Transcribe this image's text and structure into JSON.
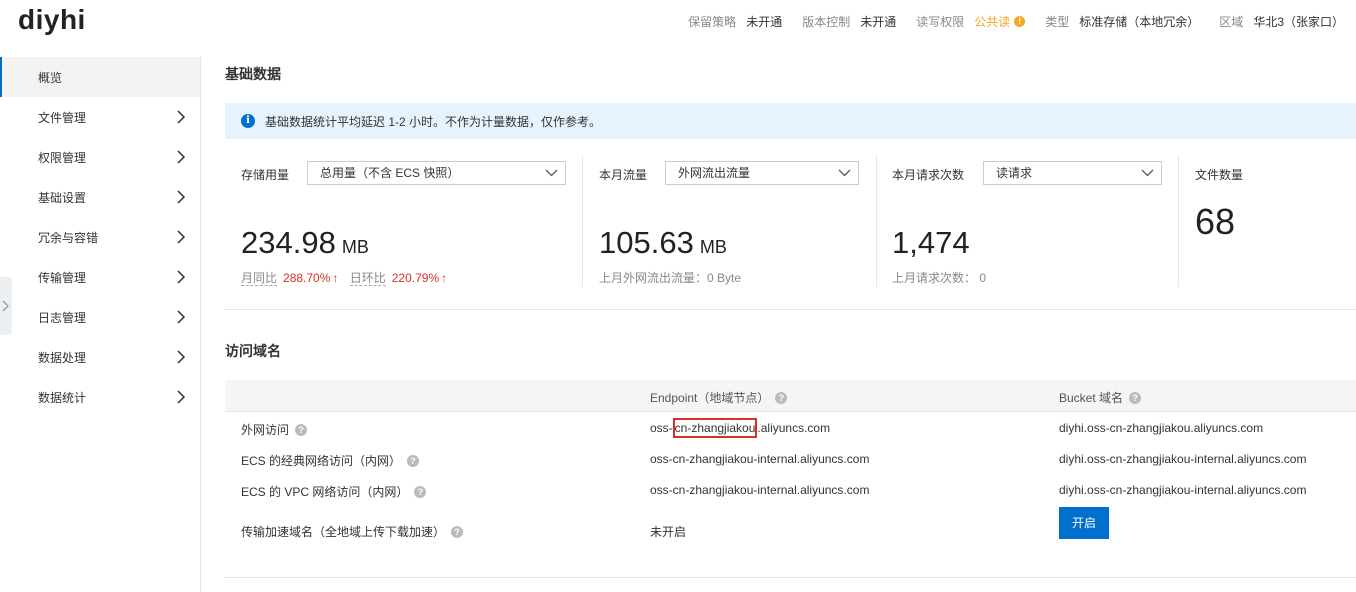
{
  "header": {
    "bucket_name": "diyhi",
    "meta": [
      {
        "label": "保留策略",
        "value": "未开通"
      },
      {
        "label": "版本控制",
        "value": "未开通"
      },
      {
        "label": "读写权限",
        "value": "公共读"
      },
      {
        "label": "类型",
        "value": "标准存储（本地冗余）"
      },
      {
        "label": "区域",
        "value": "华北3（张家口）"
      }
    ],
    "warn_glyph": "!"
  },
  "sidebar": {
    "items": [
      {
        "label": "概览"
      },
      {
        "label": "文件管理"
      },
      {
        "label": "权限管理"
      },
      {
        "label": "基础设置"
      },
      {
        "label": "冗余与容错"
      },
      {
        "label": "传输管理"
      },
      {
        "label": "日志管理"
      },
      {
        "label": "数据处理"
      },
      {
        "label": "数据统计"
      }
    ]
  },
  "basic": {
    "title": "基础数据",
    "notice": "基础数据统计平均延迟 1-2 小时。不作为计量数据，仅作参考。",
    "storage": {
      "label": "存储用量",
      "select": "总用量（不含 ECS 快照）",
      "value": "234.98",
      "unit": "MB",
      "mom_label": "月同比",
      "mom_value": "288.70%",
      "qoq_label": "日环比",
      "qoq_value": "220.79%"
    },
    "traffic": {
      "label": "本月流量",
      "select": "外网流出流量",
      "value": "105.63",
      "unit": "MB",
      "last_month": "上月外网流出流量：0 Byte"
    },
    "requests": {
      "label": "本月请求次数",
      "select": "读请求",
      "value": "1,474",
      "last_month": "上月请求次数： 0"
    },
    "files": {
      "label": "文件数量",
      "value": "68"
    }
  },
  "domains": {
    "title": "访问域名",
    "col_endpoint": "Endpoint（地域节点）",
    "col_bucket": "Bucket 域名",
    "rows": [
      {
        "name": "外网访问",
        "endpoint_pre": "oss-",
        "endpoint_hl": "cn-zhangjiakou",
        "endpoint_post": ".aliyuncs.com",
        "bucket": "diyhi.oss-cn-zhangjiakou.aliyuncs.com"
      },
      {
        "name": "ECS 的经典网络访问（内网）",
        "endpoint": "oss-cn-zhangjiakou-internal.aliyuncs.com",
        "bucket": "diyhi.oss-cn-zhangjiakou-internal.aliyuncs.com"
      },
      {
        "name": "ECS 的 VPC 网络访问（内网）",
        "endpoint": "oss-cn-zhangjiakou-internal.aliyuncs.com",
        "bucket": "diyhi.oss-cn-zhangjiakou-internal.aliyuncs.com"
      },
      {
        "name": "传输加速域名（全地域上传下载加速）",
        "endpoint": "未开启",
        "button": "开启"
      }
    ]
  }
}
